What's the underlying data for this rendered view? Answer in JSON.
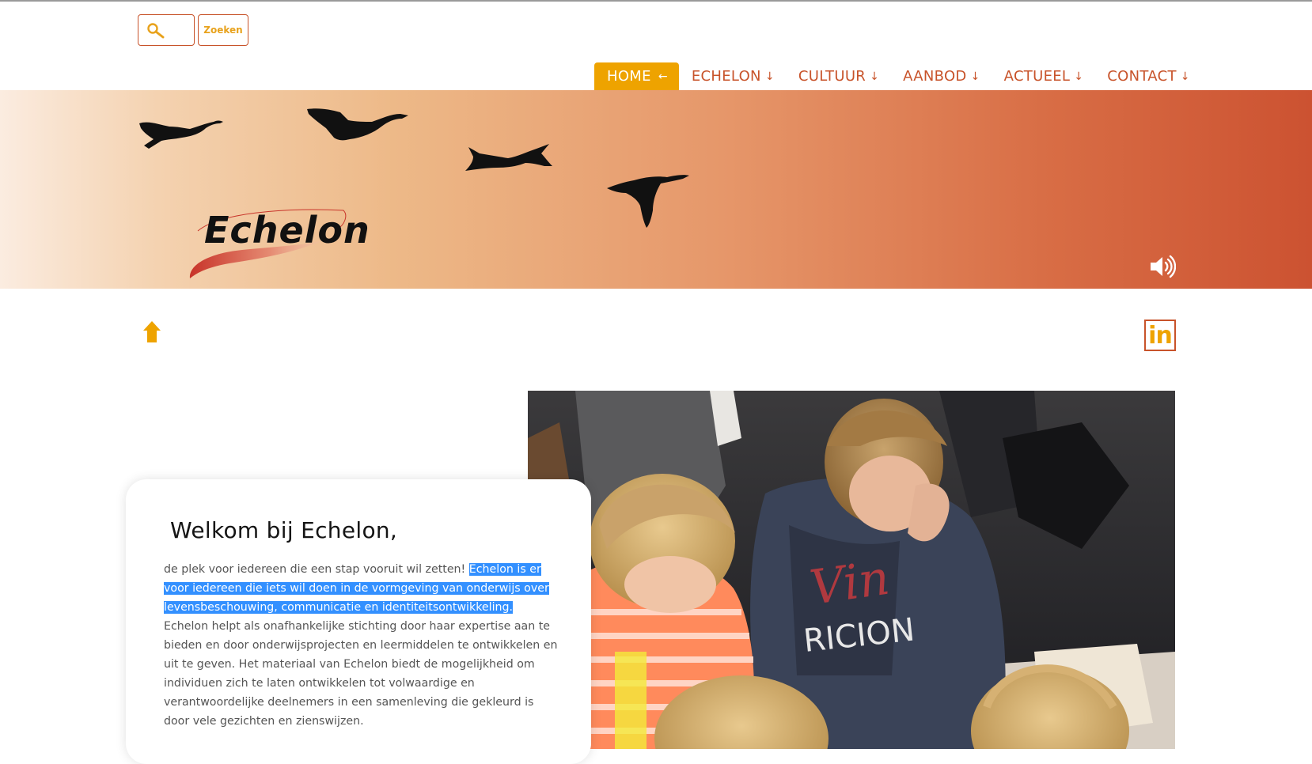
{
  "search": {
    "placeholder": "",
    "button_label": "Zoeken"
  },
  "nav": {
    "items": [
      {
        "label": "HOME",
        "arrow": "←",
        "active": true
      },
      {
        "label": "ECHELON",
        "arrow": "↓",
        "active": false
      },
      {
        "label": "CULTUUR",
        "arrow": "↓",
        "active": false
      },
      {
        "label": "AANBOD",
        "arrow": "↓",
        "active": false
      },
      {
        "label": "ACTUEEL",
        "arrow": "↓",
        "active": false
      },
      {
        "label": "CONTACT",
        "arrow": "↓",
        "active": false
      }
    ]
  },
  "banner": {
    "logo_text": "Echelon",
    "icons": [
      "goose-silhouette",
      "goose-silhouette",
      "goose-silhouette",
      "goose-silhouette",
      "speaker-icon"
    ]
  },
  "social": {
    "linkedin_label": "in"
  },
  "welcome": {
    "title": "Welkom bij Echelon,",
    "text_before": "de plek voor iedereen die een stap vooruit wil zetten! ",
    "text_selected": "Echelon is er voor iedereen die iets wil doen in de vormgeving van onderwijs over levensbeschouwing, communicatie en identiteitsontwikkeling.",
    "text_after": " Echelon helpt als onafhankelijke stichting door haar expertise aan te bieden en door onderwijsprojecten en leermiddelen te ontwikkelen en uit te geven. Het materiaal van Echelon biedt de mogelijkheid om individuen zich te laten ontwikkelen tot volwaardige en verantwoordelijke deelnemers in een samenleving die gekleurd is door vele gezichten en zienswijzen."
  },
  "colors": {
    "accent": "#eea300",
    "brand": "#c8532a",
    "selection": "#3390ff"
  }
}
